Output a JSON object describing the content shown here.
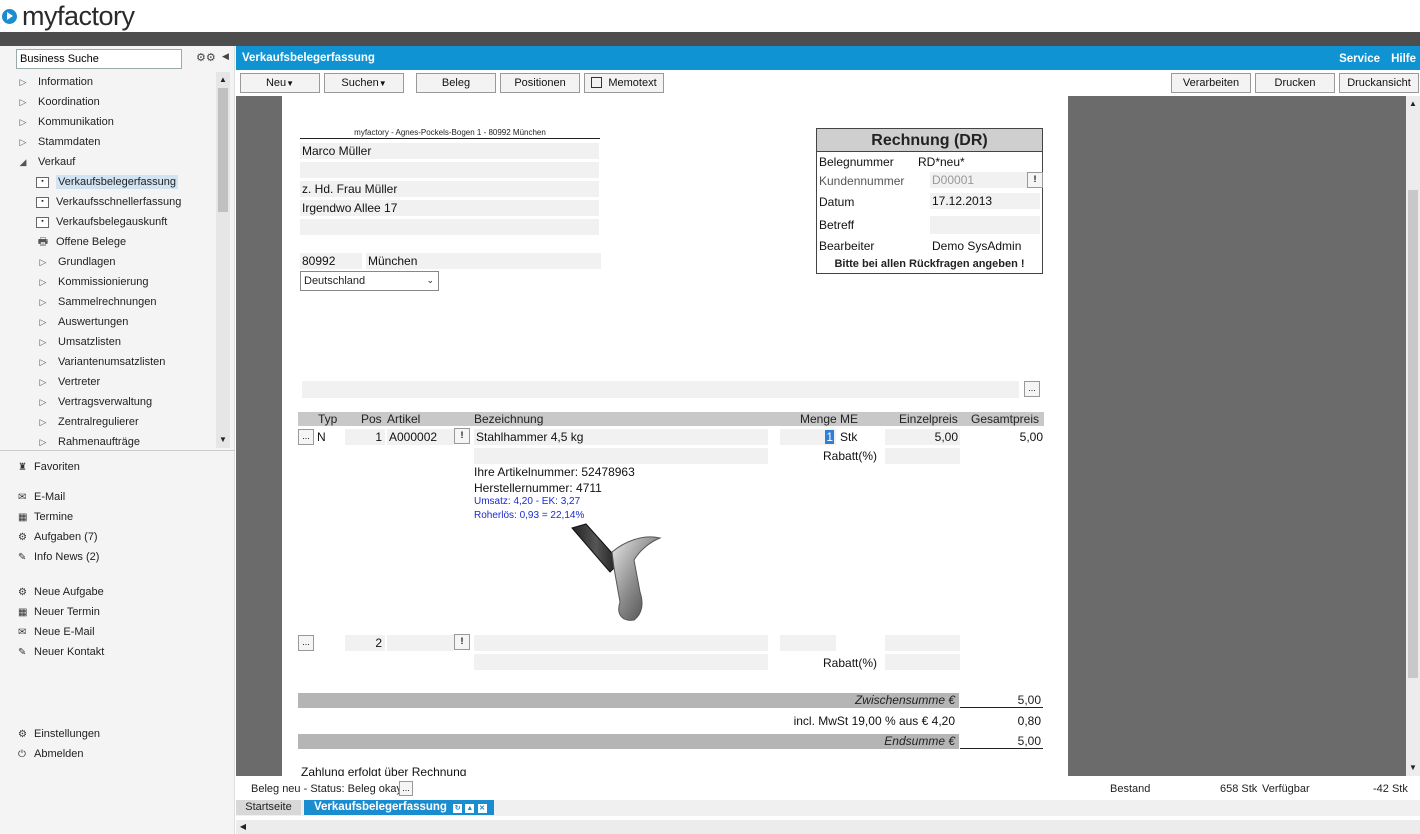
{
  "app": {
    "logo_text": "myfactory"
  },
  "sidebar": {
    "search_value": "Business Suche",
    "nav": [
      {
        "label": "Information",
        "level": 0,
        "state": "collapsed"
      },
      {
        "label": "Koordination",
        "level": 0,
        "state": "collapsed"
      },
      {
        "label": "Kommunikation",
        "level": 0,
        "state": "collapsed"
      },
      {
        "label": "Stammdaten",
        "level": 0,
        "state": "collapsed"
      },
      {
        "label": "Verkauf",
        "level": 0,
        "state": "expanded"
      },
      {
        "label": "Verkaufsbelegerfassung",
        "level": 1,
        "icon": "form",
        "selected": true
      },
      {
        "label": "Verkaufsschnellerfassung",
        "level": 1,
        "icon": "form"
      },
      {
        "label": "Verkaufsbelegauskunft",
        "level": 1,
        "icon": "form"
      },
      {
        "label": "Offene Belege",
        "level": 1,
        "icon": "printer"
      },
      {
        "label": "Grundlagen",
        "level": 1,
        "state": "collapsed"
      },
      {
        "label": "Kommissionierung",
        "level": 1,
        "state": "collapsed"
      },
      {
        "label": "Sammelrechnungen",
        "level": 1,
        "state": "collapsed"
      },
      {
        "label": "Auswertungen",
        "level": 1,
        "state": "collapsed"
      },
      {
        "label": "Umsatzlisten",
        "level": 1,
        "state": "collapsed"
      },
      {
        "label": "Variantenumsatzlisten",
        "level": 1,
        "state": "collapsed"
      },
      {
        "label": "Vertreter",
        "level": 1,
        "state": "collapsed"
      },
      {
        "label": "Vertragsverwaltung",
        "level": 1,
        "state": "collapsed"
      },
      {
        "label": "Zentralregulierer",
        "level": 1,
        "state": "collapsed"
      },
      {
        "label": "Rahmenaufträge",
        "level": 1,
        "state": "collapsed"
      }
    ],
    "favoriten": "Favoriten",
    "email": "E-Mail",
    "termine": "Termine",
    "aufgaben": "Aufgaben (7)",
    "info_news": "Info News (2)",
    "neue_aufgabe": "Neue Aufgabe",
    "neuer_termin": "Neuer Termin",
    "neue_email": "Neue E-Mail",
    "neuer_kontakt": "Neuer Kontakt",
    "einstellungen": "Einstellungen",
    "abmelden": "Abmelden"
  },
  "header": {
    "title": "Verkaufsbelegerfassung",
    "service": "Service",
    "hilfe": "Hilfe"
  },
  "toolbar": {
    "neu": "Neu",
    "suchen": "Suchen",
    "beleg": "Beleg",
    "positionen": "Positionen",
    "memotext": "Memotext",
    "verarbeiten": "Verarbeiten",
    "drucken": "Drucken",
    "druckansicht": "Druckansicht"
  },
  "document": {
    "sender_line": "myfactory - Agnes-Pockels-Bogen 1 - 80992 München",
    "address": {
      "name": "Marco Müller",
      "line2": "",
      "attn": "z. Hd. Frau Müller",
      "street": "Irgendwo Allee 17",
      "line5": "",
      "zip": "80992",
      "city": "München",
      "country": "Deutschland"
    },
    "invoice_box": {
      "title": "Rechnung (DR)",
      "belegnummer_label": "Belegnummer",
      "belegnummer": "RD*neu*",
      "kundennummer_label": "Kundennummer",
      "kundennummer": "D00001",
      "datum_label": "Datum",
      "datum": "17.12.2013",
      "betreff_label": "Betreff",
      "betreff": "",
      "bearbeiter_label": "Bearbeiter",
      "bearbeiter": "Demo SysAdmin",
      "note": "Bitte bei allen Rückfragen angeben !"
    },
    "columns": {
      "typ": "Typ",
      "pos": "Pos",
      "artikel": "Artikel",
      "bezeichnung": "Bezeichnung",
      "menge": "Menge",
      "me": "ME",
      "einzelpreis": "Einzelpreis",
      "gesamtpreis": "Gesamtpreis"
    },
    "position1": {
      "typ": "N",
      "pos": "1",
      "artikel": "A000002",
      "bezeichnung": "Stahlhammer 4,5 kg",
      "menge": "1",
      "me": "Stk",
      "einzelpreis": "5,00",
      "gesamtpreis": "5,00",
      "rabatt_label": "Rabatt(%)",
      "ihre_artikelnummer": "Ihre Artikelnummer: 52478963",
      "herstellernummer": "Herstellernummer: 4711",
      "umsatz": "Umsatz: 4,20 - EK: 3,27",
      "rohertrag": "Roherlös: 0,93 = 22,14%"
    },
    "position2": {
      "pos": "2",
      "rabatt_label": "Rabatt(%)"
    },
    "totals": {
      "zwischensumme_label": "Zwischensumme €",
      "zwischensumme": "5,00",
      "mwst_label": "incl. MwSt 19,00 % aus € 4,20",
      "mwst": "0,80",
      "endsumme_label": "Endsumme €",
      "endsumme": "5,00"
    },
    "payment_text": "Zahlung erfolgt über Rechnung"
  },
  "status": {
    "text": "Beleg neu - Status: Beleg okay",
    "bestand_label": "Bestand",
    "bestand": "658 Stk",
    "verfuegbar_label": "Verfügbar",
    "verfuegbar": "-42 Stk"
  },
  "tabs": {
    "startseite": "Startseite",
    "current": "Verkaufsbelegerfassung"
  },
  "colors": {
    "accent": "#0f93d2",
    "topbar": "#4d4d4d",
    "canvas": "#6b6b6b",
    "link_blue": "#1a2bd0"
  }
}
